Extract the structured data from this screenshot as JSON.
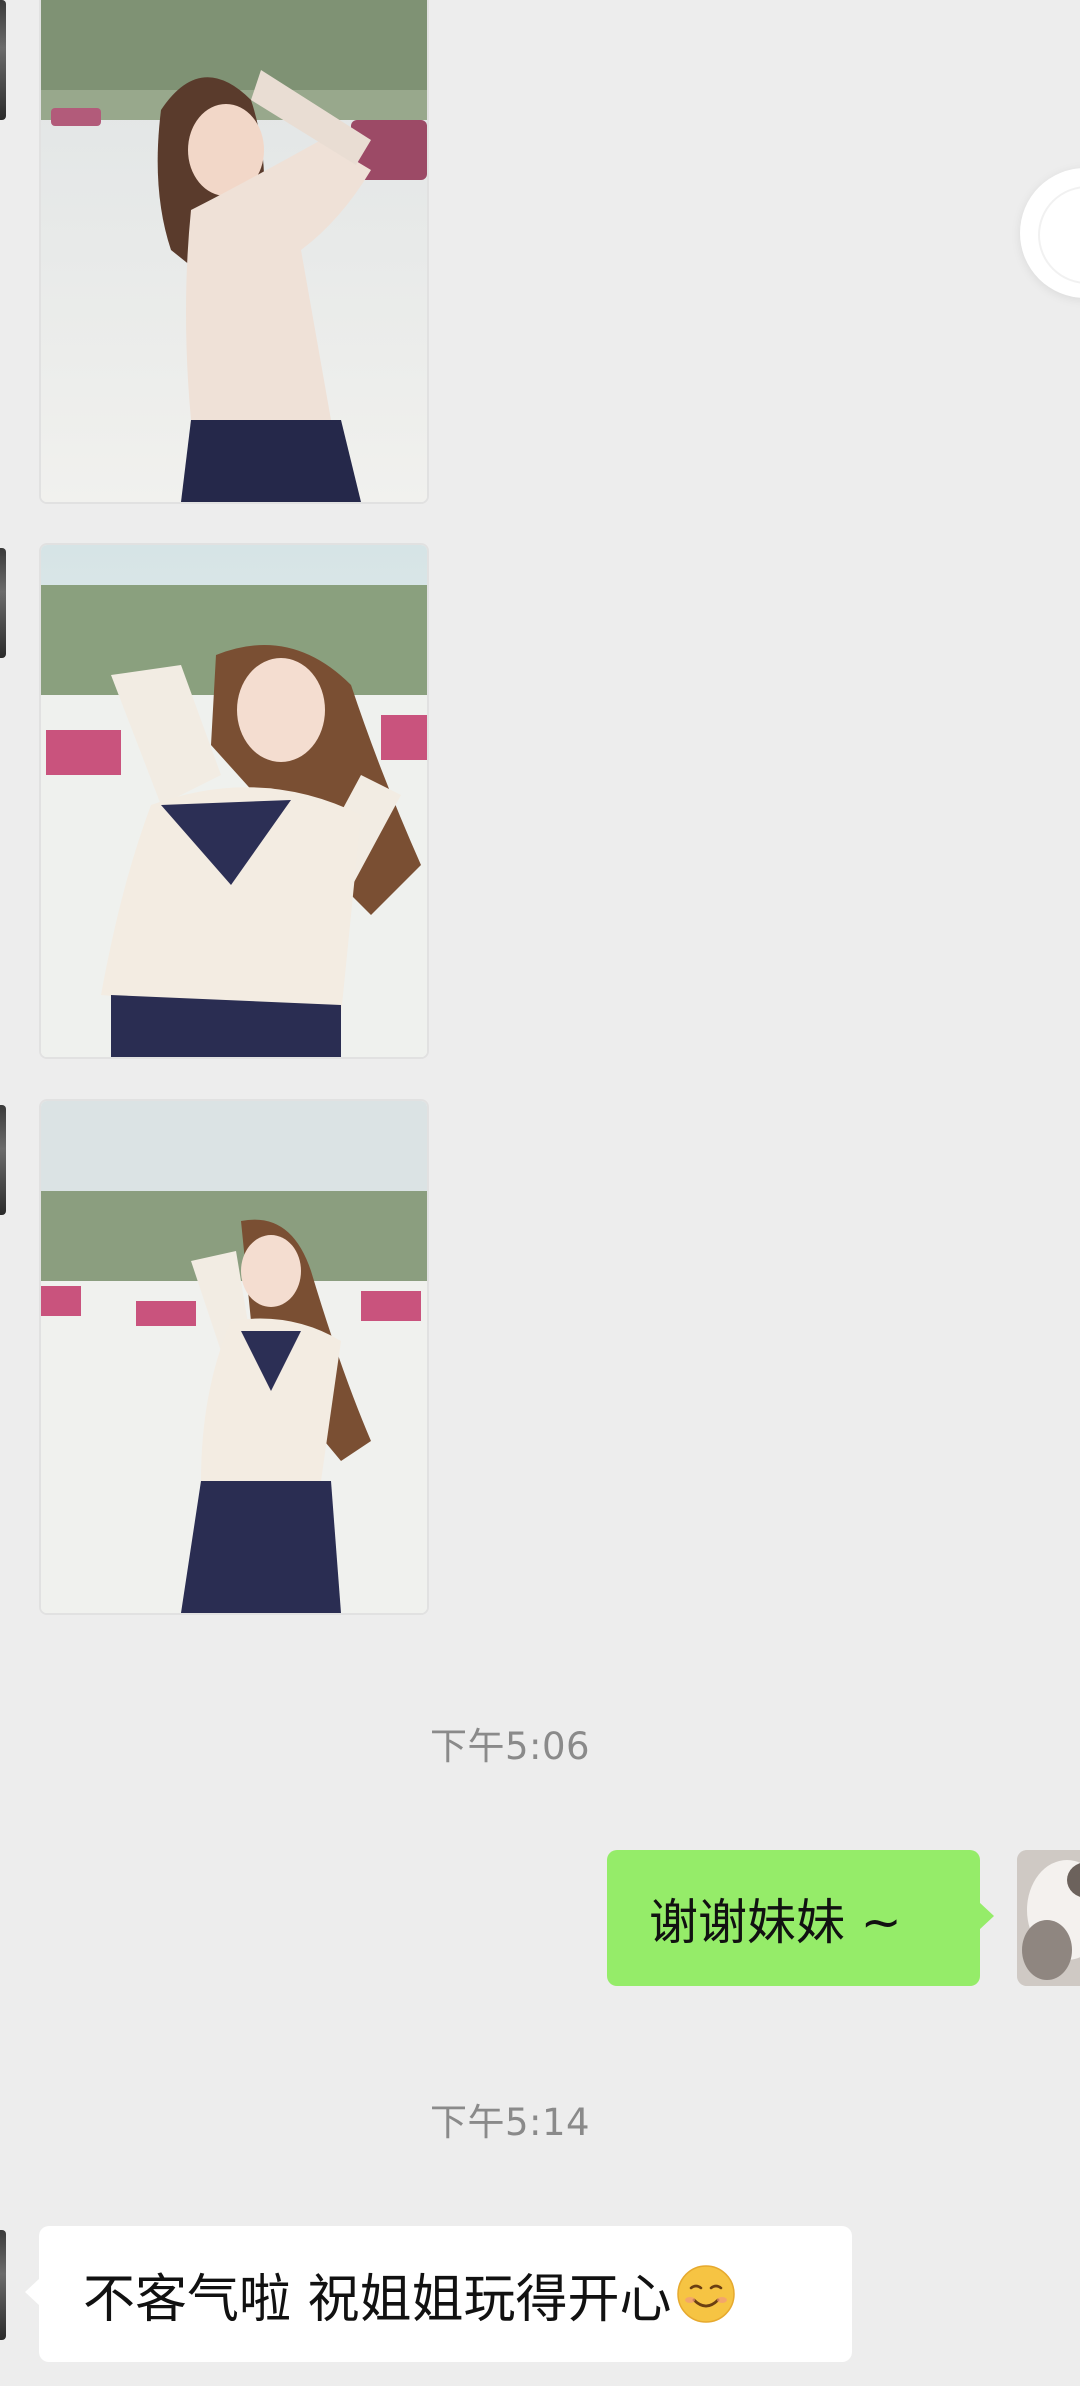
{
  "messages": {
    "timestamp_1": "下午5:06",
    "outgoing_text": "谢谢妹妹 ~",
    "timestamp_2": "下午5:14",
    "incoming_text": "不客气啦 祝姐姐玩得开心",
    "incoming_emoji": "smiling-face-emoji"
  },
  "photos": [
    {
      "description_icon": "photo-thumbnail"
    },
    {
      "description_icon": "photo-thumbnail"
    },
    {
      "description_icon": "photo-thumbnail"
    }
  ],
  "colors": {
    "background": "#ededed",
    "outgoing_bubble": "#95ec69",
    "incoming_bubble": "#ffffff",
    "timestamp_text": "#8a8a8a"
  }
}
